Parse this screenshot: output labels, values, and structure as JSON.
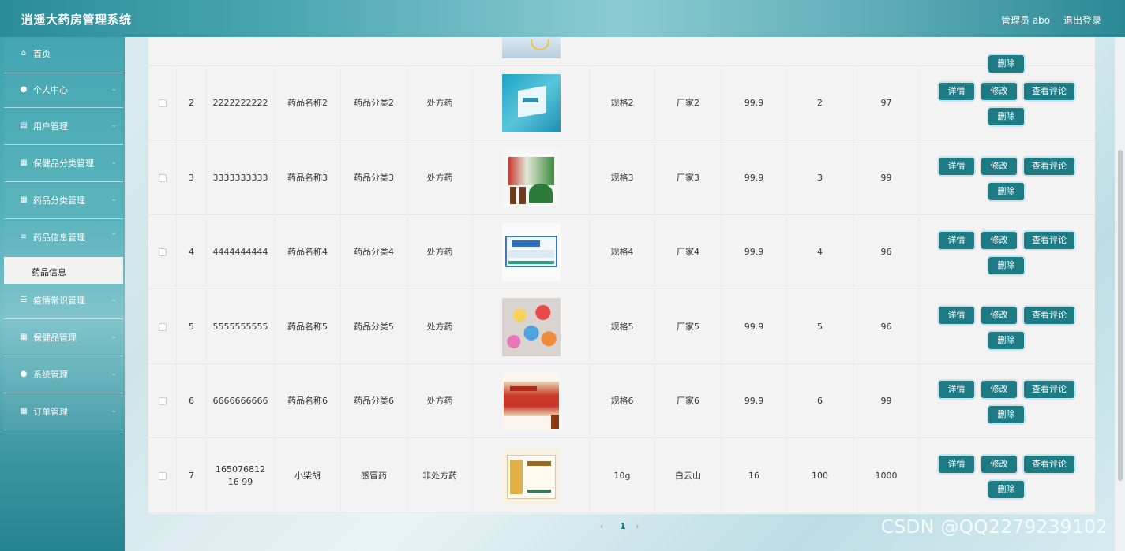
{
  "header": {
    "title": "逍遥大药房管理系统",
    "admin": "管理员 abo",
    "logout": "退出登录"
  },
  "sidebar": {
    "items": [
      {
        "label": "首页",
        "icon": "home-icon",
        "glyph": "⌂"
      },
      {
        "label": "个人中心",
        "icon": "person-icon",
        "glyph": "●"
      },
      {
        "label": "用户管理",
        "icon": "user-mgmt-icon",
        "glyph": "▤"
      },
      {
        "label": "保健品分类管理",
        "icon": "grid-icon",
        "glyph": "▦"
      },
      {
        "label": "药品分类管理",
        "icon": "grid-icon",
        "glyph": "▦"
      },
      {
        "label": "药品信息管理",
        "icon": "sliders-icon",
        "glyph": "≡"
      },
      {
        "label": "疫情常识管理",
        "icon": "list-icon",
        "glyph": "☰"
      },
      {
        "label": "保健品管理",
        "icon": "grid-icon",
        "glyph": "▦"
      },
      {
        "label": "系统管理",
        "icon": "location-icon",
        "glyph": "●"
      },
      {
        "label": "订单管理",
        "icon": "grid-icon",
        "glyph": "▦"
      }
    ],
    "sub_item": "药品信息"
  },
  "actions": {
    "detail": "详情",
    "edit": "修改",
    "comments": "查看评论",
    "delete": "删除"
  },
  "rows": [
    {
      "idx": "2",
      "code": "2222222222",
      "name": "药品名称2",
      "category": "药品分类2",
      "type": "处方药",
      "spec": "规格2",
      "maker": "厂家2",
      "price": "99.9",
      "c1": "2",
      "c2": "97"
    },
    {
      "idx": "3",
      "code": "3333333333",
      "name": "药品名称3",
      "category": "药品分类3",
      "type": "处方药",
      "spec": "规格3",
      "maker": "厂家3",
      "price": "99.9",
      "c1": "3",
      "c2": "99"
    },
    {
      "idx": "4",
      "code": "4444444444",
      "name": "药品名称4",
      "category": "药品分类4",
      "type": "处方药",
      "spec": "规格4",
      "maker": "厂家4",
      "price": "99.9",
      "c1": "4",
      "c2": "96"
    },
    {
      "idx": "5",
      "code": "5555555555",
      "name": "药品名称5",
      "category": "药品分类5",
      "type": "处方药",
      "spec": "规格5",
      "maker": "厂家5",
      "price": "99.9",
      "c1": "5",
      "c2": "96"
    },
    {
      "idx": "6",
      "code": "6666666666",
      "name": "药品名称6",
      "category": "药品分类6",
      "type": "处方药",
      "spec": "规格6",
      "maker": "厂家6",
      "price": "99.9",
      "c1": "6",
      "c2": "99"
    },
    {
      "idx": "7",
      "code": "16507681216 99",
      "name": "小柴胡",
      "category": "感冒药",
      "type": "非处方药",
      "spec": "10g",
      "maker": "白云山",
      "price": "16",
      "c1": "100",
      "c2": "1000"
    }
  ],
  "pager": {
    "prev": "‹",
    "page": "1",
    "next": "›"
  },
  "watermark": "CSDN @QQ2279239102"
}
